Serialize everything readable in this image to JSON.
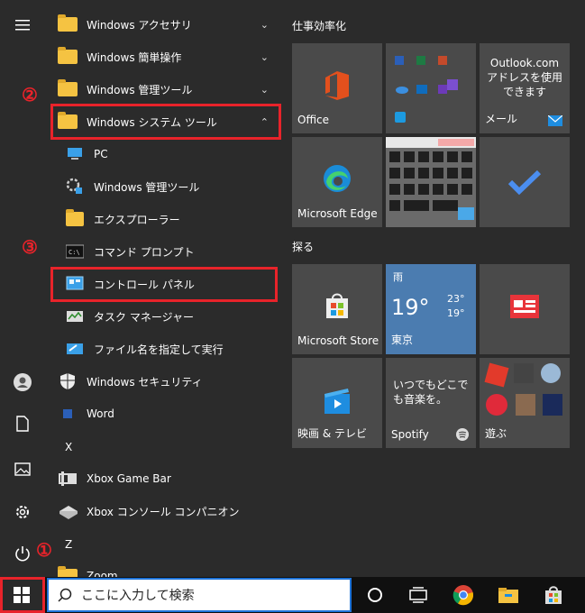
{
  "apps": [
    {
      "label": "Windows アクセサリ",
      "type": "folder",
      "chev": "⌄"
    },
    {
      "label": "Windows 簡単操作",
      "type": "folder",
      "chev": "⌄"
    },
    {
      "label": "Windows 管理ツール",
      "type": "folder",
      "chev": "⌄"
    },
    {
      "label": "Windows システム ツール",
      "type": "folder",
      "chev": "⌃"
    },
    {
      "label": "PC",
      "type": "sub"
    },
    {
      "label": "Windows 管理ツール",
      "type": "sub"
    },
    {
      "label": "エクスプローラー",
      "type": "sub"
    },
    {
      "label": "コマンド プロンプト",
      "type": "sub"
    },
    {
      "label": "コントロール パネル",
      "type": "sub"
    },
    {
      "label": "タスク マネージャー",
      "type": "sub"
    },
    {
      "label": "ファイル名を指定して実行",
      "type": "sub"
    },
    {
      "label": "Windows セキュリティ",
      "type": "app"
    },
    {
      "label": "Word",
      "type": "app"
    },
    {
      "label": "X",
      "type": "letter"
    },
    {
      "label": "Xbox Game Bar",
      "type": "app"
    },
    {
      "label": "Xbox コンソール コンパニオン",
      "type": "app"
    },
    {
      "label": "Z",
      "type": "letter"
    },
    {
      "label": "Zoom",
      "type": "folder",
      "chev": "⌄"
    }
  ],
  "annotations": {
    "one": "①",
    "two": "②",
    "three": "③"
  },
  "groups": {
    "productivity": "仕事効率化",
    "explore": "探る"
  },
  "tiles": {
    "office": "Office",
    "outlook_text": "Outlook.com アドレスを使用できます",
    "mail": "メール",
    "edge": "Microsoft Edge",
    "store": "Microsoft Store",
    "weather_cond": "雨",
    "weather_temp": "19°",
    "weather_high": "23°",
    "weather_low": "19°",
    "weather_city": "東京",
    "movies": "映画 & テレビ",
    "spotify_text": "いつでもどこでも音楽を。",
    "spotify": "Spotify",
    "play": "遊ぶ"
  },
  "taskbar": {
    "search_placeholder": "ここに入力して検索"
  }
}
